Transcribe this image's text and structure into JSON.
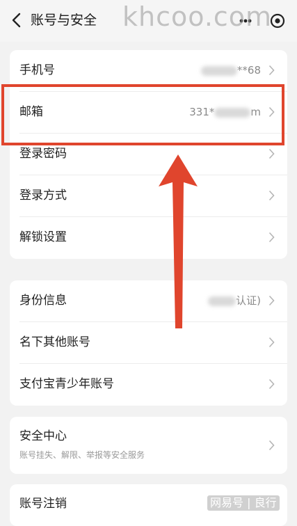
{
  "header": {
    "title": "账号与安全",
    "back_icon": "chevron-left-icon",
    "more_icon": "more-dots-icon",
    "target_icon": "target-icon"
  },
  "watermark": "khcoo.com",
  "groups": [
    {
      "rows": [
        {
          "label": "手机号",
          "value_tail": "**68"
        },
        {
          "label": "邮箱",
          "value_head": "331*",
          "value_tail": "m"
        },
        {
          "label": "登录密码"
        },
        {
          "label": "登录方式"
        },
        {
          "label": "解锁设置"
        }
      ]
    },
    {
      "rows": [
        {
          "label": "身份信息",
          "value_tail": "认证)"
        },
        {
          "label": "名下其他账号"
        },
        {
          "label": "支付宝青少年账号"
        }
      ]
    },
    {
      "rows": [
        {
          "label": "安全中心",
          "sub": "账号挂失、解限、举报等安全服务"
        }
      ]
    },
    {
      "rows": [
        {
          "label": "账号注销"
        }
      ]
    }
  ],
  "credit": "网易号 | 良行",
  "colors": {
    "annotation": "#e0452d",
    "background": "#f2f2f2",
    "card": "#ffffff"
  }
}
